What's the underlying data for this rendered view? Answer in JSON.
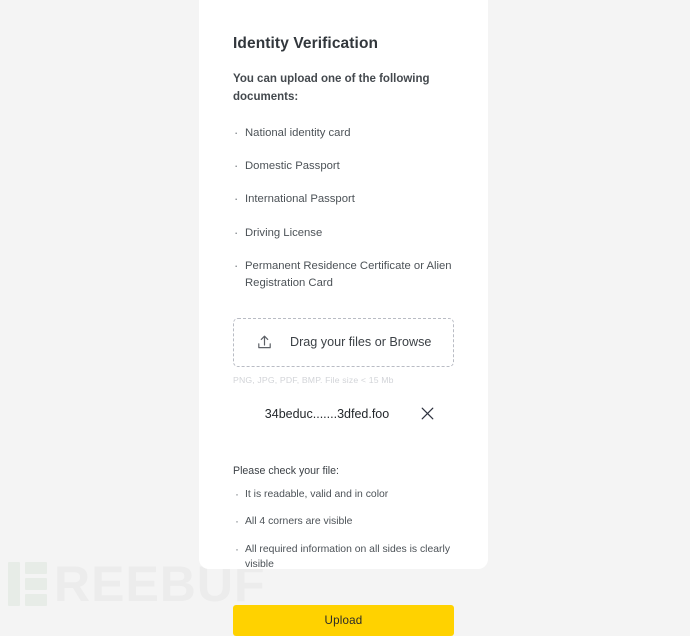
{
  "card": {
    "title": "Identity Verification",
    "intro": "You can upload one of the following documents:",
    "documents": [
      "National identity card",
      "Domestic Passport",
      "International Passport",
      "Driving License",
      "Permanent Residence Certificate or Alien Registration Card"
    ],
    "dropzone": {
      "icon": "upload-icon",
      "label": "Drag your files or Browse",
      "hint": "PNG, JPG, PDF, BMP. File size < 15 Mb"
    },
    "file": {
      "name": "34beduc.......3dfed.foo",
      "remove_icon": "close-icon"
    },
    "checklist": {
      "heading": "Please check your file:",
      "items": [
        "It is readable, valid and in color",
        "All 4 corners are visible",
        "All required information on all sides is clearly visible"
      ]
    },
    "submit_label": "Upload"
  },
  "watermark": {
    "text": "REEBUF",
    "mark": "freebuf-logo-icon"
  },
  "colors": {
    "accent_yellow": "#ffd200",
    "page_background": "#f4f4f4",
    "card_background": "#ffffff",
    "title_text": "#32373c",
    "body_text": "#4c5257",
    "hint_text": "#d2d4d8",
    "dropzone_border": "#b9bcc4",
    "watermark": "#ececec"
  }
}
